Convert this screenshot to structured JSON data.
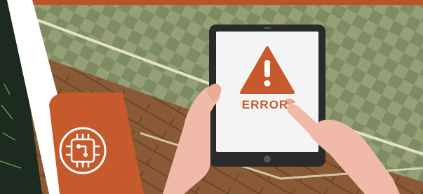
{
  "tablet": {
    "status_text": "ERROR",
    "warning_icon": "warning-triangle-icon"
  },
  "badge": {
    "icon": "circuit-board-icon"
  },
  "colors": {
    "top_bar": "#b8532a",
    "floor_wood": "#8a5a36",
    "wall_green": "#8f9a72",
    "accent_orange": "#c65a2c",
    "tablet_body": "#2a2a2a",
    "screen": "#f4f4f4",
    "skin": "#f0b9a8"
  }
}
